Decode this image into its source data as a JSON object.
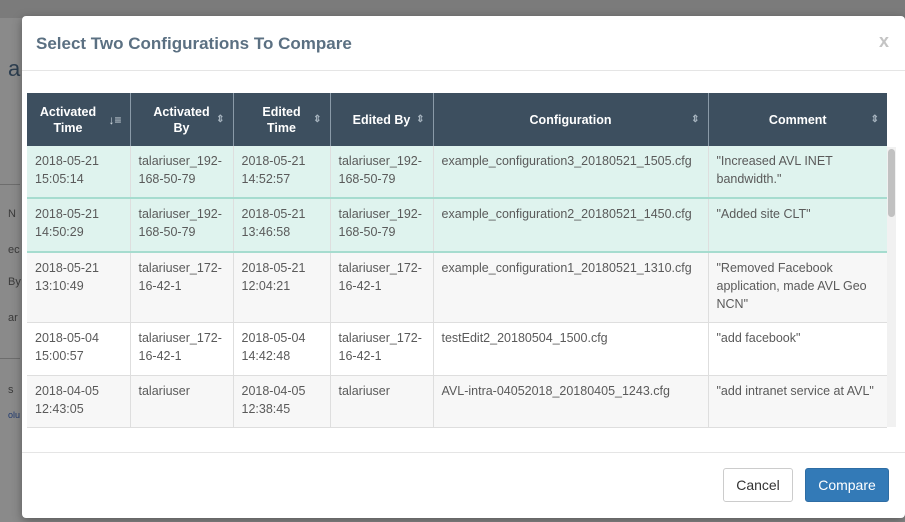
{
  "backdrop": {
    "fragments": [
      "a",
      "N",
      "ec",
      "By",
      "ar",
      "s",
      "olu"
    ]
  },
  "modal": {
    "title": "Select Two Configurations To Compare",
    "close_glyph": "x",
    "cancel_label": "Cancel",
    "compare_label": "Compare"
  },
  "table": {
    "headers": [
      "Activated Time",
      "Activated By",
      "Edited Time",
      "Edited By",
      "Configuration",
      "Comment"
    ],
    "rows": [
      {
        "activated_time": "2018-05-21 15:05:14",
        "activated_by": "talariuser_192-168-50-79",
        "edited_time": "2018-05-21 14:52:57",
        "edited_by": "talariuser_192-168-50-79",
        "configuration": "example_configuration3_20180521_1505.cfg",
        "comment": "\"Increased AVL INET bandwidth.\"",
        "selected": true
      },
      {
        "activated_time": "2018-05-21 14:50:29",
        "activated_by": "talariuser_192-168-50-79",
        "edited_time": "2018-05-21 13:46:58",
        "edited_by": "talariuser_192-168-50-79",
        "configuration": "example_configuration2_20180521_1450.cfg",
        "comment": "\"Added site CLT\"",
        "selected": true
      },
      {
        "activated_time": "2018-05-21 13:10:49",
        "activated_by": "talariuser_172-16-42-1",
        "edited_time": "2018-05-21 12:04:21",
        "edited_by": "talariuser_172-16-42-1",
        "configuration": "example_configuration1_20180521_1310.cfg",
        "comment": "\"Removed Facebook application, made AVL Geo NCN\"",
        "selected": false
      },
      {
        "activated_time": "2018-05-04 15:00:57",
        "activated_by": "talariuser_172-16-42-1",
        "edited_time": "2018-05-04 14:42:48",
        "edited_by": "talariuser_172-16-42-1",
        "configuration": "testEdit2_20180504_1500.cfg",
        "comment": "\"add facebook\"",
        "selected": false
      },
      {
        "activated_time": "2018-04-05 12:43:05",
        "activated_by": "talariuser",
        "edited_time": "2018-04-05 12:38:45",
        "edited_by": "talariuser",
        "configuration": "AVL-intra-04052018_20180405_1243.cfg",
        "comment": "\"add intranet service at AVL\"",
        "selected": false
      }
    ]
  },
  "colors": {
    "header_bg": "#3d4f5f",
    "selected_row": "#dff3ee",
    "primary_button": "#337ab7"
  }
}
